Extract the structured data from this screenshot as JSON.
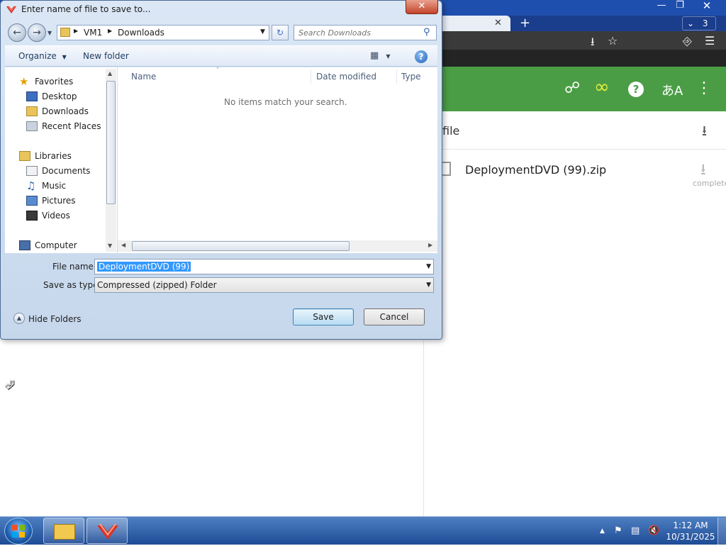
{
  "browser": {
    "tab_count": "3",
    "panel_title": "file",
    "download_item": {
      "filename": "DeploymentDVD (99).zip",
      "status": "complete"
    },
    "icons": [
      "download-icon",
      "star-icon",
      "extension-icon",
      "menu-icon",
      "share-icon",
      "infinity-icon",
      "help-icon",
      "translate-icon",
      "more-icon"
    ],
    "accent_color": "#4b9d45"
  },
  "dialog": {
    "title": "Enter name of file to save to...",
    "address": {
      "segments": [
        "VM1",
        "Downloads"
      ]
    },
    "search": {
      "placeholder": "Search Downloads"
    },
    "toolbar": {
      "organize": "Organize",
      "new_folder": "New folder"
    },
    "nav": {
      "favorites": {
        "label": "Favorites",
        "items": [
          "Desktop",
          "Downloads",
          "Recent Places"
        ]
      },
      "libraries": {
        "label": "Libraries",
        "items": [
          "Documents",
          "Music",
          "Pictures",
          "Videos"
        ]
      },
      "computer": "Computer"
    },
    "columns": [
      "Name",
      "Date modified",
      "Type"
    ],
    "empty_message": "No items match your search.",
    "file_name_label": "File name:",
    "file_name_value": "DeploymentDVD (99)",
    "save_as_type_label": "Save as type:",
    "save_as_type_value": "Compressed (zipped) Folder",
    "hide_folders": "Hide Folders",
    "save": "Save",
    "cancel": "Cancel"
  },
  "taskbar": {
    "time": "1:12 AM",
    "date": "10/31/2025"
  }
}
